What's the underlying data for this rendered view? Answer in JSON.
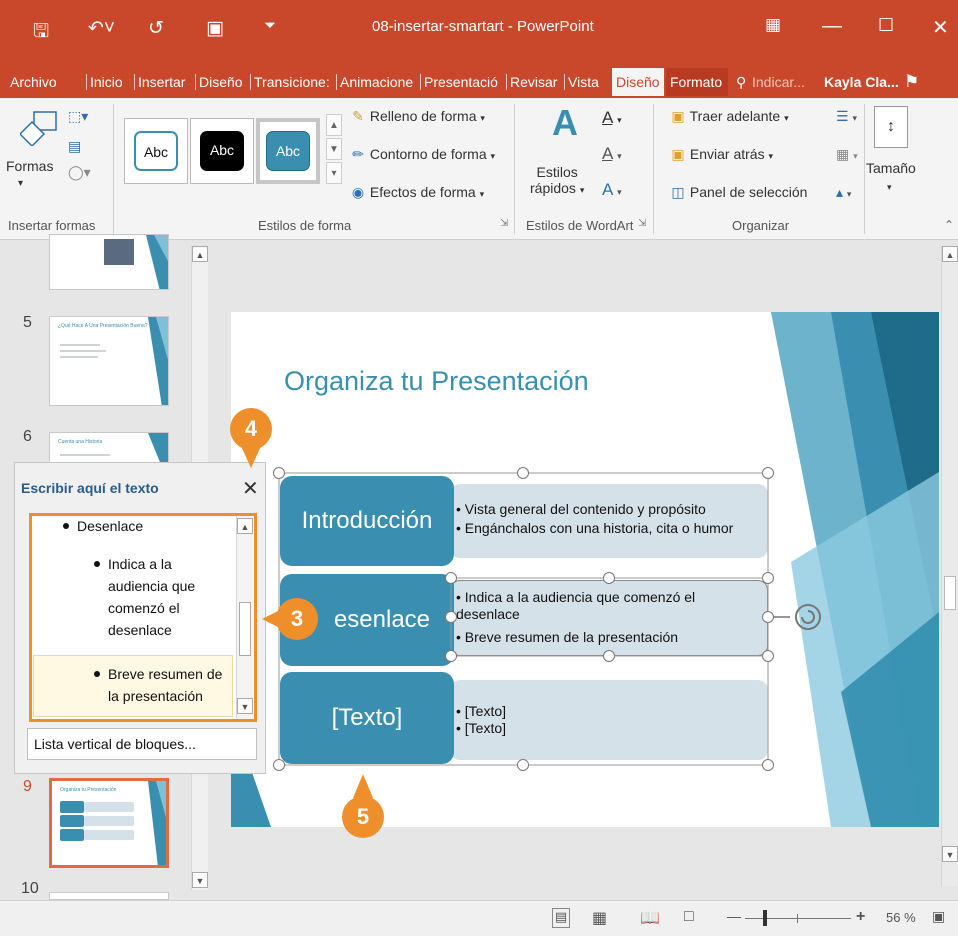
{
  "app": {
    "document_title": "08-insertar-smartart - PowerPoint",
    "colors": {
      "accent": "#c9482b",
      "slide_blue": "#3a8fb0",
      "callout": "#ef8f2c"
    }
  },
  "quick_access": {
    "save_icon": "save-icon",
    "undo_icon": "undo-icon",
    "redo_icon": "repeat-icon",
    "present_icon": "present-from-start-icon",
    "customize_icon": "customize-icon"
  },
  "tabs": {
    "archivo": "Archivo",
    "inicio": "Inicio",
    "insertar": "Insertar",
    "diseno": "Diseño",
    "transiciones": "Transicione:",
    "animaciones": "Animacione",
    "presentacion": "Presentació",
    "revisar": "Revisar",
    "vista": "Vista",
    "diseno_ctx": "Diseño",
    "formato": "Formato",
    "tell_me": "Indicar...",
    "user": "Kayla Cla..."
  },
  "ribbon": {
    "insert_shapes": {
      "formas": "Formas",
      "group": "Insertar formas"
    },
    "shape_styles": {
      "sample": "Abc",
      "relleno": "Relleno de forma",
      "contorno": "Contorno de forma",
      "efectos": "Efectos de forma",
      "group": "Estilos de forma"
    },
    "wordart": {
      "estilos": "Estilos",
      "rapidos": "rápidos",
      "group": "Estilos de WordArt"
    },
    "arrange": {
      "traer": "Traer adelante",
      "enviar": "Enviar atrás",
      "panel": "Panel de selección",
      "group": "Organizar"
    },
    "size": {
      "tamano": "Tamaño"
    }
  },
  "thumbnails": [
    {
      "number": "5",
      "title": "¿Qué Hace A Una Presentación Buena?"
    },
    {
      "number": "6",
      "title": "Cuenta una Historia"
    },
    {
      "number": "9",
      "title": "Organiza tu Presentación"
    },
    {
      "number": "10",
      "title": ""
    }
  ],
  "slide": {
    "title": "Organiza tu Presentación",
    "blocks": [
      {
        "label": "Introducción",
        "bullets": [
          "• Vista general del contenido y propósito",
          "• Engánchalos con una historia, cita o humor"
        ]
      },
      {
        "label": "esenlace",
        "bullets": [
          "• Indica a la audiencia que comenzó el",
          "   desenlace",
          "• Breve resumen de la presentación"
        ]
      },
      {
        "label": "[Texto]",
        "bullets": [
          "• [Texto]",
          "• [Texto]"
        ]
      }
    ]
  },
  "text_pane": {
    "title": "Escribir aquí el texto",
    "items": [
      {
        "text": "Desenlace"
      },
      {
        "lines": [
          "Indica a la",
          "audiencia que",
          "comenzó el",
          "desenlace"
        ]
      },
      {
        "lines": [
          "Breve resumen de",
          "la presentación"
        ]
      }
    ],
    "layout_name": "Lista vertical de bloques..."
  },
  "callouts": {
    "c3": "3",
    "c4": "4",
    "c5": "5"
  },
  "statusbar": {
    "zoom": "56 %"
  }
}
